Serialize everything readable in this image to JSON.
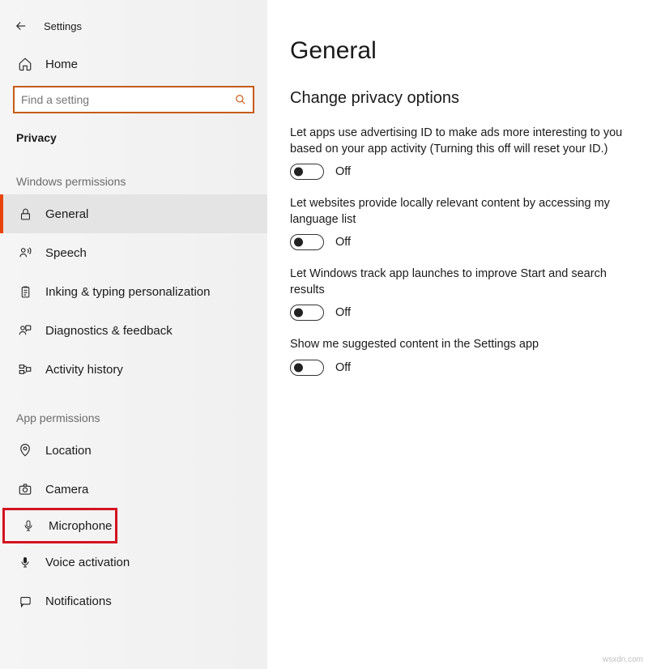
{
  "app_title": "Settings",
  "search": {
    "placeholder": "Find a setting"
  },
  "home_label": "Home",
  "current_category": "Privacy",
  "section1_header": "Windows permissions",
  "section2_header": "App permissions",
  "nav_win": {
    "general": "General",
    "speech": "Speech",
    "inking": "Inking & typing personalization",
    "diag": "Diagnostics & feedback",
    "activity": "Activity history"
  },
  "nav_app": {
    "location": "Location",
    "camera": "Camera",
    "microphone": "Microphone",
    "voice": "Voice activation",
    "notifications": "Notifications"
  },
  "main": {
    "title": "General",
    "section_title": "Change privacy options",
    "s1_desc": "Let apps use advertising ID to make ads more interesting to you based on your app activity (Turning this off will reset your ID.)",
    "s1_state": "Off",
    "s2_desc": "Let websites provide locally relevant content by accessing my language list",
    "s2_state": "Off",
    "s3_desc": "Let Windows track app launches to improve Start and search results",
    "s3_state": "Off",
    "s4_desc": "Show me suggested content in the Settings app",
    "s4_state": "Off"
  },
  "watermark": "wsxdn.com"
}
